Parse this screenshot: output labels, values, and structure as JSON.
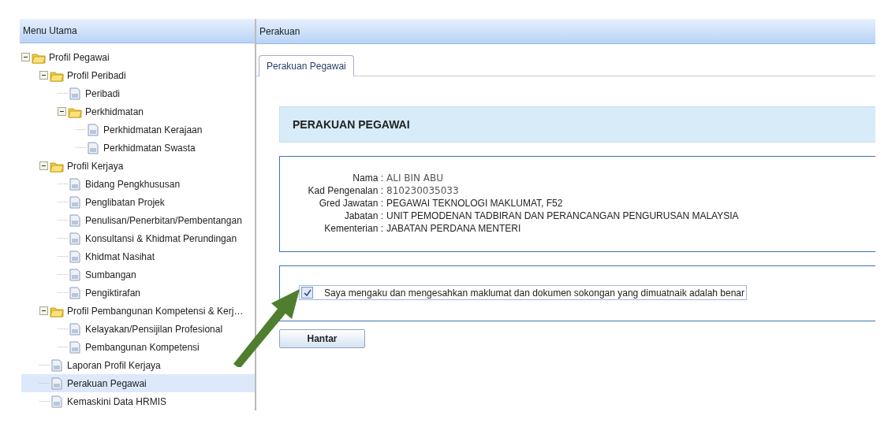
{
  "sidebar": {
    "title": "Menu Utama",
    "tree": [
      {
        "label": "Profil Pegawai",
        "kind": "folder",
        "expanded": true,
        "selected": false,
        "children": [
          {
            "label": "Profil Peribadi",
            "kind": "folder",
            "expanded": true,
            "selected": false,
            "children": [
              {
                "label": "Peribadi",
                "kind": "page",
                "selected": false
              },
              {
                "label": "Perkhidmatan",
                "kind": "folder",
                "expanded": true,
                "selected": false,
                "children": [
                  {
                    "label": "Perkhidmatan Kerajaan",
                    "kind": "page",
                    "selected": false
                  },
                  {
                    "label": "Perkhidmatan Swasta",
                    "kind": "page",
                    "selected": false
                  }
                ]
              }
            ]
          },
          {
            "label": "Profil Kerjaya",
            "kind": "folder",
            "expanded": true,
            "selected": false,
            "children": [
              {
                "label": "Bidang Pengkhususan",
                "kind": "page",
                "selected": false
              },
              {
                "label": "Penglibatan Projek",
                "kind": "page",
                "selected": false
              },
              {
                "label": "Penulisan/Penerbitan/Pembentangan",
                "kind": "page",
                "selected": false
              },
              {
                "label": "Konsultansi & Khidmat Perundingan",
                "kind": "page",
                "selected": false
              },
              {
                "label": "Khidmat Nasihat",
                "kind": "page",
                "selected": false
              },
              {
                "label": "Sumbangan",
                "kind": "page",
                "selected": false
              },
              {
                "label": "Pengiktirafan",
                "kind": "page",
                "selected": false
              }
            ]
          },
          {
            "label": "Profil Pembangunan Kompetensi & Kerj…",
            "kind": "folder",
            "expanded": true,
            "selected": false,
            "children": [
              {
                "label": "Kelayakan/Pensijilan Profesional",
                "kind": "page",
                "selected": false
              },
              {
                "label": "Pembangunan Kompetensi",
                "kind": "page",
                "selected": false
              }
            ]
          },
          {
            "label": "Laporan Profil Kerjaya",
            "kind": "page",
            "selected": false
          },
          {
            "label": "Perakuan Pegawai",
            "kind": "page",
            "selected": true
          },
          {
            "label": "Kemaskini Data HRMIS",
            "kind": "page",
            "selected": false
          }
        ]
      }
    ]
  },
  "main": {
    "title": "Perakuan",
    "tabs": [
      {
        "label": "Perakuan Pegawai",
        "selected": true
      }
    ],
    "heading": "PERAKUAN PEGAWAI",
    "fields": [
      {
        "label": "Nama :",
        "value": "ALI BIN ABU",
        "kind": "typed"
      },
      {
        "label": "Kad Pengenalan :",
        "value": "810230035033",
        "kind": "typed"
      },
      {
        "label": "Gred Jawatan :",
        "value": "PEGAWAI TEKNOLOGI MAKLUMAT, F52",
        "kind": "plain"
      },
      {
        "label": "Jabatan :",
        "value": "UNIT PEMODENAN TADBIRAN DAN PERANCANGAN PENGURUSAN MALAYSIA",
        "kind": "plain"
      },
      {
        "label": "Kementerian :",
        "value": "JABATAN PERDANA MENTERI",
        "kind": "plain"
      }
    ],
    "declaration": {
      "text": "Saya mengaku dan mengesahkan maklumat dan dokumen sokongan yang dimuatnaik adalah benar",
      "checked": true
    },
    "submit": "Hantar"
  }
}
